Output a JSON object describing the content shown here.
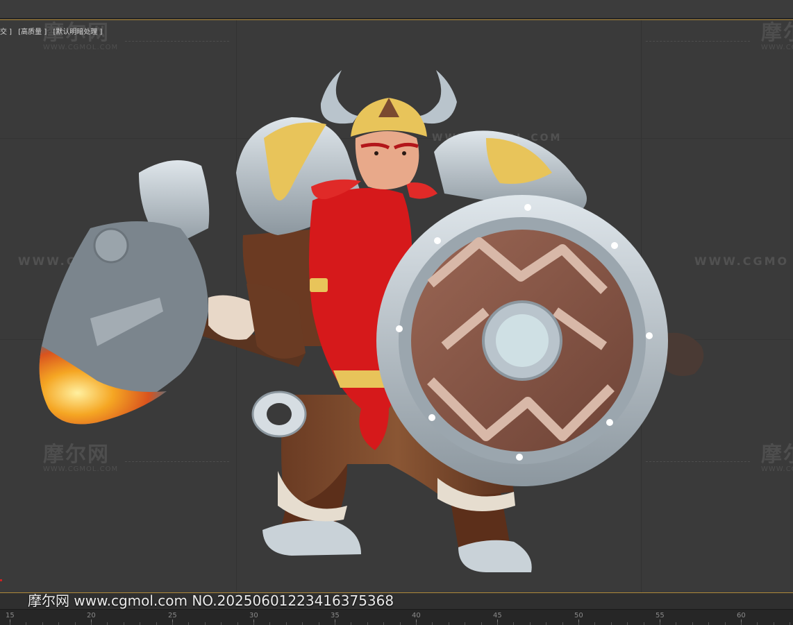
{
  "viewport": {
    "labels": [
      "交 ]",
      "[高质量 ]",
      "[默认明暗处理 ]"
    ]
  },
  "watermarks": {
    "brand_cn": "摩尔网",
    "brand_cn_short": "摩尔",
    "brand_url": "WWW.CGMOL.COM",
    "brand_url_short": "WWW.CGMO"
  },
  "caption": "摩尔网 www.cgmol.com NO.20250601223416375368",
  "timeline": {
    "ticks": [
      "15",
      "20",
      "25",
      "30",
      "35",
      "40",
      "45",
      "50",
      "55",
      "60"
    ]
  },
  "colors": {
    "viewport_bg": "#3a3a3a",
    "border_accent": "#b08a3a",
    "beard": "#d6191b",
    "armor": "#b9c4cc",
    "gold": "#e8c45a",
    "shield_wood": "#8a5a4a"
  }
}
